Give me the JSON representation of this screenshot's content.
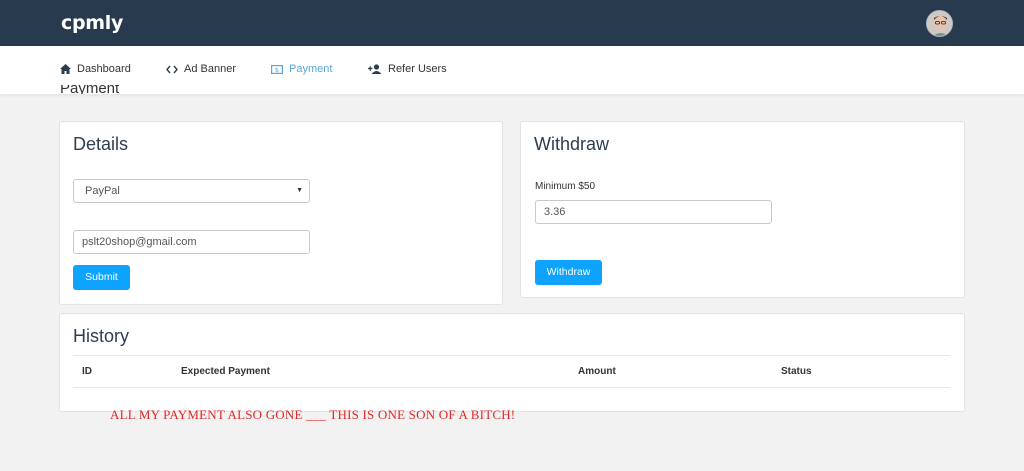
{
  "brand": {
    "logo_text": "cpmly"
  },
  "nav": {
    "items": [
      {
        "label": "Dashboard",
        "icon": "home-icon"
      },
      {
        "label": "Ad Banner",
        "icon": "code-icon"
      },
      {
        "label": "Payment",
        "icon": "money-icon",
        "active": true
      },
      {
        "label": "Refer Users",
        "icon": "add-user-icon"
      }
    ]
  },
  "page": {
    "title": "Payment"
  },
  "details": {
    "title": "Details",
    "method_selected": "PayPal",
    "email_value": "pslt20shop@gmail.com",
    "submit_label": "Submit"
  },
  "withdraw": {
    "title": "Withdraw",
    "minimum_label": "Minimum $50",
    "amount_value": "3.36",
    "button_label": "Withdraw"
  },
  "history": {
    "title": "History",
    "columns": [
      "ID",
      "Expected Payment",
      "Amount",
      "Status"
    ],
    "rows": []
  },
  "annotation": {
    "text": "ALL MY PAYMENT ALSO GONE ___ THIS IS ONE SON OF A BITCH!"
  },
  "colors": {
    "topbar": "#283a4e",
    "accent": "#0da3ff",
    "active_nav": "#5aa7d9",
    "annotation": "#e02a2a"
  }
}
